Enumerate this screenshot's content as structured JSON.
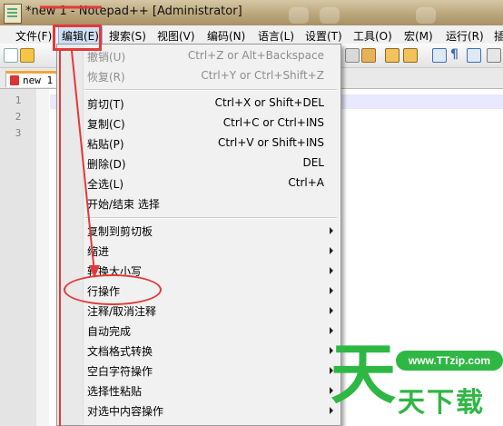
{
  "window": {
    "title": "*new 1 - Notepad++ [Administrator]"
  },
  "menubar": {
    "items": [
      "文件(F)",
      "编辑(E)",
      "搜索(S)",
      "视图(V)",
      "编码(N)",
      "语言(L)",
      "设置(T)",
      "工具(O)",
      "宏(M)",
      "运行(R)",
      "插"
    ],
    "active": "编辑(E)"
  },
  "tab": {
    "label": "new 1"
  },
  "editor": {
    "line_numbers": [
      "1",
      "2",
      "3"
    ]
  },
  "edit_menu": {
    "items": [
      {
        "label": "撤销(U)",
        "shortcut": "Ctrl+Z or Alt+Backspace",
        "disabled": true
      },
      {
        "label": "恢复(R)",
        "shortcut": "Ctrl+Y or Ctrl+Shift+Z",
        "disabled": true
      },
      {
        "label": "剪切(T)",
        "shortcut": "Ctrl+X or Shift+DEL"
      },
      {
        "label": "复制(C)",
        "shortcut": "Ctrl+C or Ctrl+INS"
      },
      {
        "label": "粘贴(P)",
        "shortcut": "Ctrl+V or Shift+INS"
      },
      {
        "label": "删除(D)",
        "shortcut": "DEL"
      },
      {
        "label": "全选(L)",
        "shortcut": "Ctrl+A"
      },
      {
        "label": "开始/结束 选择",
        "shortcut": ""
      },
      {
        "label": "复制到剪切板",
        "submenu": true
      },
      {
        "label": "缩进",
        "submenu": true
      },
      {
        "label": "转换大小写",
        "submenu": true
      },
      {
        "label": "行操作",
        "submenu": true,
        "highlighted_by_annotation": true
      },
      {
        "label": "注释/取消注释",
        "submenu": true
      },
      {
        "label": "自动完成",
        "submenu": true
      },
      {
        "label": "文档格式转换",
        "submenu": true
      },
      {
        "label": "空白字符操作",
        "submenu": true
      },
      {
        "label": "选择性粘贴",
        "submenu": true
      },
      {
        "label": "对选中内容操作",
        "submenu": true
      }
    ]
  },
  "watermark": {
    "url": "www.TTzip.com",
    "big_char": "天",
    "sub_text": "天下载"
  },
  "colors": {
    "annotation": "#e23a3a",
    "watermark": "#2fb744",
    "active_menu": "#cfe0f5"
  }
}
